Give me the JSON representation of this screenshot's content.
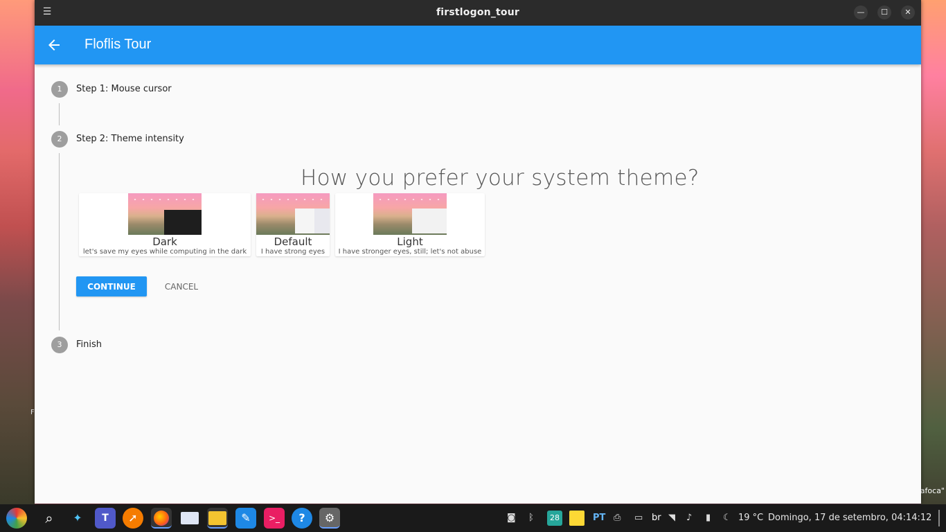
{
  "window": {
    "title": "firstlogon_tour",
    "minimize_icon": "minimize-icon",
    "maximize_icon": "maximize-icon",
    "close_icon": "close-icon"
  },
  "appbar": {
    "title": "Floflis Tour",
    "back_icon": "arrow-left-icon",
    "color": "#2196f3"
  },
  "steps": [
    {
      "number": "1",
      "label": "Step 1: Mouse cursor"
    },
    {
      "number": "2",
      "label": "Step 2: Theme intensity"
    },
    {
      "number": "3",
      "label": "Finish"
    }
  ],
  "theme_step": {
    "question": "How you prefer your system theme?",
    "options": [
      {
        "name": "Dark",
        "description": "let's save my eyes while computing in the dark"
      },
      {
        "name": "Default",
        "description": "I have strong eyes"
      },
      {
        "name": "Light",
        "description": "I have stronger eyes, still; let's not abuse"
      }
    ],
    "continue_label": "CONTINUE",
    "cancel_label": "CANCEL"
  },
  "desktop": {
    "wallpaper_text": "afoca\"",
    "edge_text": "F"
  },
  "taskbar": {
    "apps": [
      "start-icon",
      "search-icon",
      "assistant-icon",
      "teams-icon",
      "rocket-icon",
      "firefox-icon",
      "mail-icon",
      "files-icon",
      "notes-icon",
      "terminal-icon",
      "help-icon",
      "settings-icon"
    ],
    "keyboard_layout": "PT",
    "input_lang": "br",
    "calendar_day": "28",
    "temperature": "19 °C",
    "clock": "Domingo, 17 de setembro, 04:14:12"
  }
}
